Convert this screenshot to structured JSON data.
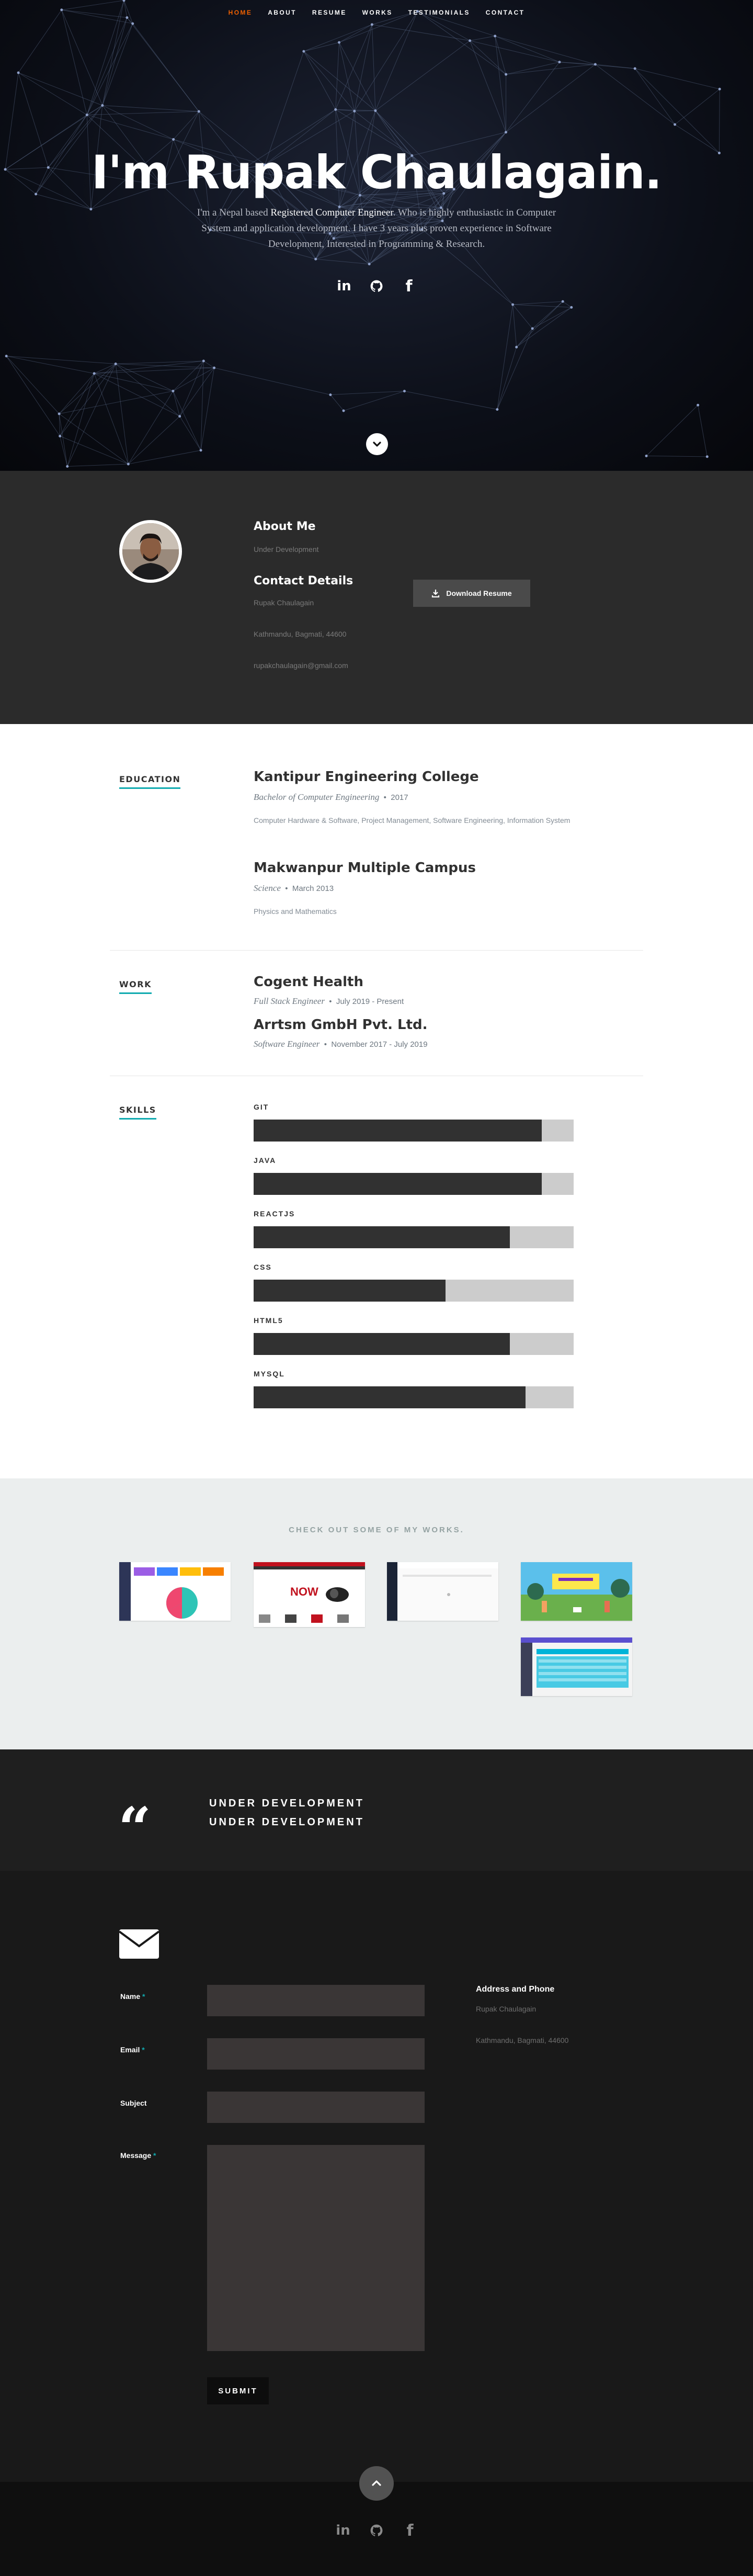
{
  "nav": {
    "items": [
      {
        "label": "HOME"
      },
      {
        "label": "ABOUT"
      },
      {
        "label": "RESUME"
      },
      {
        "label": "WORKS"
      },
      {
        "label": "TESTIMONIALS"
      },
      {
        "label": "CONTACT"
      }
    ],
    "active_color": "#f06000"
  },
  "hero": {
    "title": "I'm Rupak Chaulagain.",
    "intro_pre": "I'm a Nepal based ",
    "intro_strong": "Registered Computer Engineer",
    "intro_post": ". Who is highly enthusiastic in Computer System and application development. I have 3 years plus proven experience in Software Development, Interested in Programming & Research.",
    "social": [
      {
        "icon": "linkedin-icon",
        "glyph": "in"
      },
      {
        "icon": "github-icon",
        "glyph": ""
      },
      {
        "icon": "facebook-icon",
        "glyph": "f"
      }
    ]
  },
  "about": {
    "about_title": "About Me",
    "about_text": "Under Development",
    "contact_title": "Contact Details",
    "name": "Rupak Chaulagain",
    "address": "Kathmandu, Bagmati, 44600",
    "email": "rupakchaulagain@gmail.com",
    "download_label": "Download Resume"
  },
  "resume": {
    "education_heading": "EDUCATION",
    "education": [
      {
        "school": "Kantipur Engineering College",
        "degree": "Bachelor of Computer Engineering",
        "date": "2017",
        "desc": "Computer Hardware & Software, Project Management, Software Engineering, Information System"
      },
      {
        "school": "Makwanpur Multiple Campus",
        "degree": "Science",
        "date": "March 2013",
        "desc": "Physics and Mathematics"
      }
    ],
    "work_heading": "WORK",
    "work": [
      {
        "company": "Cogent Health",
        "title": "Full Stack Engineer",
        "date": "July 2019 - Present"
      },
      {
        "company": "Arrtsm GmbH Pvt. Ltd.",
        "title": "Software Engineer",
        "date": "November 2017 - July 2019"
      }
    ],
    "skills_heading": "SKILLS",
    "skills": [
      {
        "name": "GIT",
        "level": 0.9
      },
      {
        "name": "JAVA",
        "level": 0.9
      },
      {
        "name": "REACTJS",
        "level": 0.8
      },
      {
        "name": "CSS",
        "level": 0.6
      },
      {
        "name": "HTML5",
        "level": 0.8
      },
      {
        "name": "MYSQL",
        "level": 0.85
      }
    ],
    "accent": "#11abb0"
  },
  "works": {
    "heading": "CHECK OUT SOME OF MY WORKS.",
    "thumb_text": "NOW"
  },
  "testimonials": {
    "line1": "UNDER DEVELOPMENT",
    "line2": "UNDER DEVELOPMENT"
  },
  "contact": {
    "name_label": "Name",
    "email_label": "Email",
    "subject_label": "Subject",
    "message_label": "Message",
    "required_mark": "*",
    "submit_label": "SUBMIT",
    "address_title": "Address and Phone",
    "name": "Rupak Chaulagain",
    "address": "Kathmandu, Bagmati, 44600"
  }
}
